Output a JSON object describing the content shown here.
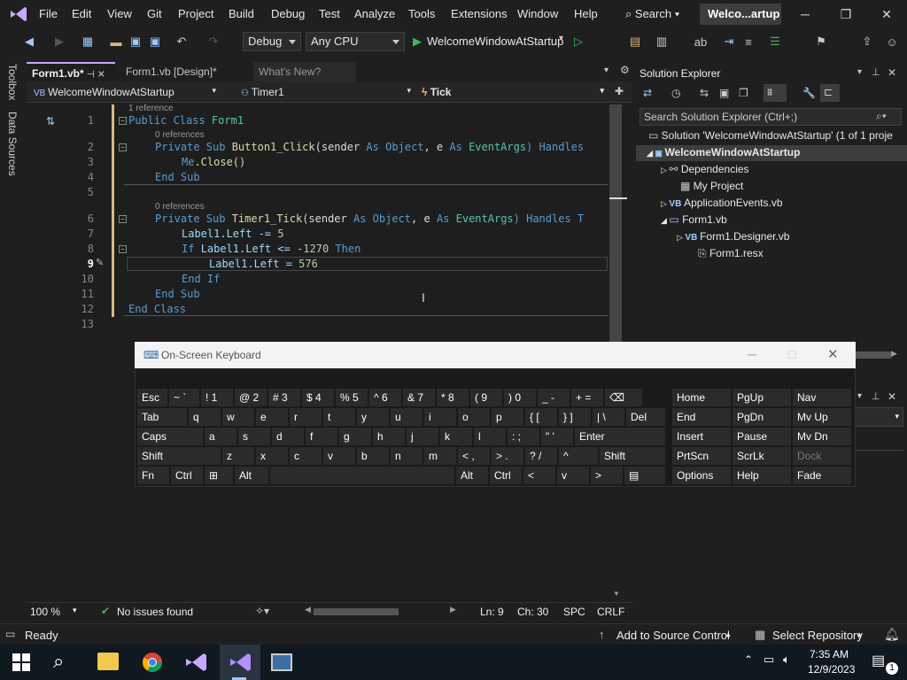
{
  "menu": [
    "File",
    "Edit",
    "View",
    "Git",
    "Project",
    "Build",
    "Debug",
    "Test",
    "Analyze",
    "Tools",
    "Extensions",
    "Window",
    "Help"
  ],
  "search_label": "Search",
  "window_title": "Welco...artup",
  "toolbar": {
    "config": "Debug",
    "platform": "Any CPU",
    "start_label": "WelcomeWindowAtStartup"
  },
  "left_rail": {
    "toolbox": "Toolbox",
    "data_sources": "Data Sources"
  },
  "tabs": [
    {
      "label": "Form1.vb*",
      "active": true
    },
    {
      "label": "Form1.vb [Design]*",
      "active": false
    },
    {
      "label": "What's New?",
      "active": false
    }
  ],
  "nav": {
    "project": "WelcomeWindowAtStartup",
    "object": "Timer1",
    "event": "Tick"
  },
  "code": {
    "ref1": "1 reference",
    "ref2": "0 references",
    "ref3": "0 references",
    "line_numbers": [
      "1",
      "2",
      "3",
      "4",
      "5",
      "6",
      "7",
      "8",
      "9",
      "10",
      "11",
      "12",
      "13"
    ],
    "l1": {
      "a": "Public Class ",
      "b": "Form1"
    },
    "l2": {
      "a": "Private Sub ",
      "b": "Button1_Click",
      "c": "(sender ",
      "d": "As ",
      "e": "Object",
      ",": ", e ",
      "g": "As ",
      "h": "EventArgs",
      ")": ") Handles"
    },
    "l3": {
      "a": "Me",
      "b": ".Close()"
    },
    "l4": "End Sub",
    "l6": {
      "a": "Private Sub ",
      "b": "Timer1_Tick",
      "c": "(sender ",
      "d": "As ",
      "e": "Object",
      "f": ", e ",
      "g": "As ",
      "h": "EventArgs",
      "i": ") Handles T"
    },
    "l7": {
      "a": "Label1.Left -= ",
      "b": "5"
    },
    "l8": {
      "a": "If ",
      "b": "Label1.Left <= -",
      "c": "1270",
      "d": " Then"
    },
    "l9": {
      "a": "Label1.Left = ",
      "b": "576"
    },
    "l10": "End If",
    "l11": "End Sub",
    "l12": "End Class"
  },
  "editor_status": {
    "zoom": "100 %",
    "issues": "No issues found",
    "ln": "Ln: 9",
    "ch": "Ch: 30",
    "spc": "SPC",
    "crlf": "CRLF"
  },
  "solution_explorer": {
    "title": "Solution Explorer",
    "search_placeholder": "Search Solution Explorer (Ctrl+;)",
    "items": [
      {
        "label": "Solution 'WelcomeWindowAtStartup' (1 of 1 proje"
      },
      {
        "label": "WelcomeWindowAtStartup"
      },
      {
        "label": "Dependencies"
      },
      {
        "label": "My Project"
      },
      {
        "label": "ApplicationEvents.vb"
      },
      {
        "label": "Form1.vb"
      },
      {
        "label": "Form1.Designer.vb"
      },
      {
        "label": "Form1.resx"
      }
    ]
  },
  "osk": {
    "title": "On-Screen Keyboard",
    "rows": [
      [
        "Esc",
        "~ `",
        "! 1",
        "@ 2",
        "# 3",
        "$ 4",
        "% 5",
        "^ 6",
        "& 7",
        "* 8",
        "( 9",
        ") 0",
        "_ -",
        "+ =",
        "⌫"
      ],
      [
        "Tab",
        "q",
        "w",
        "e",
        "r",
        "t",
        "y",
        "u",
        "i",
        "o",
        "p",
        "{ [",
        "} ]",
        "| \\",
        "Del"
      ],
      [
        "Caps",
        "a",
        "s",
        "d",
        "f",
        "g",
        "h",
        "j",
        "k",
        "l",
        ": ;",
        "\" '",
        "Enter"
      ],
      [
        "Shift",
        "z",
        "x",
        "c",
        "v",
        "b",
        "n",
        "m",
        "< ,",
        "> .",
        "? /",
        "^",
        "Shift"
      ],
      [
        "Fn",
        "Ctrl",
        "⊞",
        "Alt",
        "",
        "Alt",
        "Ctrl",
        "<",
        "v",
        ">",
        "▤"
      ]
    ],
    "nav_keys": [
      [
        "Home",
        "PgUp",
        "Nav"
      ],
      [
        "End",
        "PgDn",
        "Mv Up"
      ],
      [
        "Insert",
        "Pause",
        "Mv Dn"
      ],
      [
        "PrtScn",
        "ScrLk",
        "Dock"
      ],
      [
        "Options",
        "Help",
        "Fade"
      ]
    ]
  },
  "statusbar": {
    "ready": "Ready",
    "source_control": "Add to Source Control",
    "repo": "Select Repository"
  },
  "clock": {
    "time": "7:35 AM",
    "date": "12/9/2023"
  },
  "notification_count": "1"
}
